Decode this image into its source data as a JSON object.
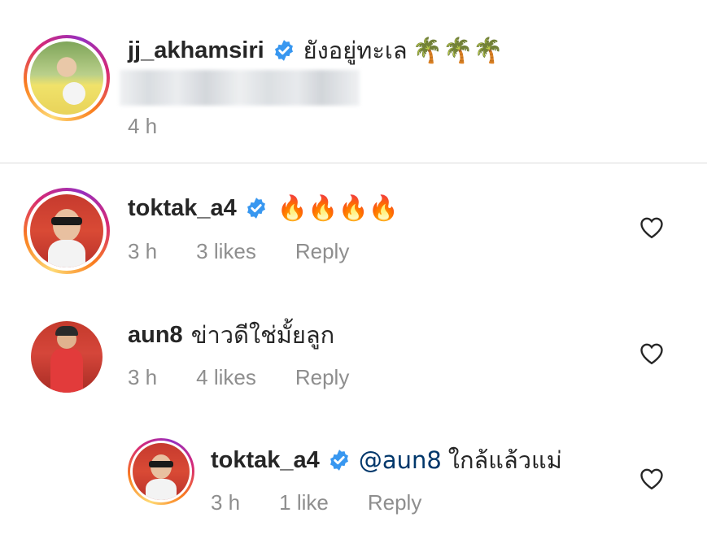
{
  "post": {
    "username": "jj_akhamsiri",
    "caption": "ยังอยู่ทะเล",
    "emoji": "🌴🌴🌴",
    "time": "4 h"
  },
  "comments": [
    {
      "username": "toktak_a4",
      "verified": true,
      "text": "",
      "emoji": "🔥🔥🔥🔥",
      "time": "3 h",
      "likes": "3 likes",
      "reply": "Reply"
    },
    {
      "username": "aun8",
      "verified": false,
      "text": "ข่าวดีใช่มั้ยลูก",
      "time": "3 h",
      "likes": "4 likes",
      "reply": "Reply"
    }
  ],
  "reply": {
    "username": "toktak_a4",
    "verified": true,
    "mention": "@aun8",
    "text": "ใกล้แล้วแม่",
    "time": "3 h",
    "likes": "1 like",
    "reply": "Reply"
  },
  "colors": {
    "verified_blue": "#3897f0",
    "meta_gray": "#8e8e8e",
    "mention_blue": "#00376b",
    "divider": "#dbdbdb"
  },
  "icons": [
    "verified-badge-icon",
    "heart-icon"
  ]
}
